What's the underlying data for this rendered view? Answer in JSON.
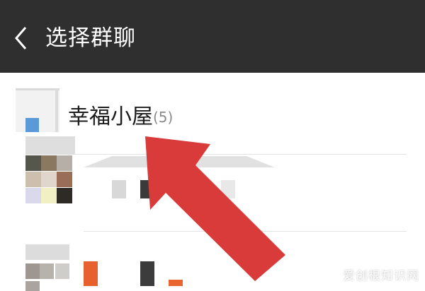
{
  "header": {
    "title": "选择群聊",
    "back_icon": "chevron-left-icon"
  },
  "groups": [
    {
      "name": "幸福小屋",
      "member_count": "(5)"
    }
  ],
  "colors": {
    "titlebar": "#2f2f2f",
    "arrow": "#d93a3a"
  },
  "watermark": "爱创根知识网"
}
